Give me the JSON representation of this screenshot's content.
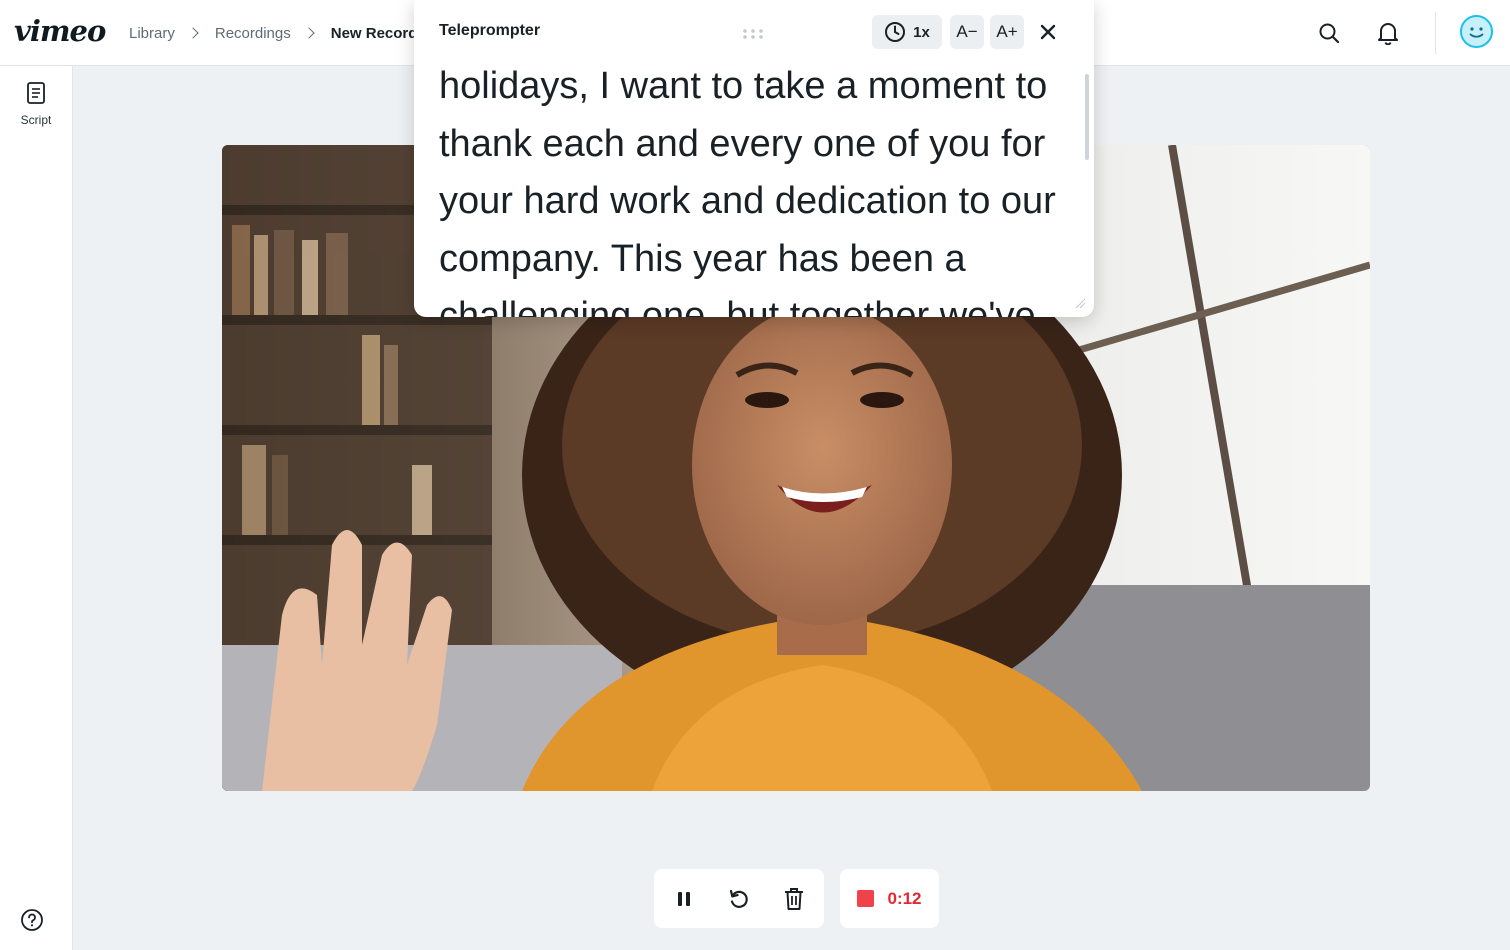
{
  "app": {
    "logo": "vimeo"
  },
  "breadcrumb": [
    {
      "label": "Library"
    },
    {
      "label": "Recordings"
    },
    {
      "label": "New Recordir"
    }
  ],
  "header_icons": [
    "search-icon",
    "bell-icon",
    "avatar"
  ],
  "sidebar": {
    "script_label": "Script",
    "script_icon": "document-icon",
    "help_icon": "help-icon"
  },
  "teleprompter": {
    "title": "Teleprompter",
    "speed": "1x",
    "font_decrease": "A−",
    "font_increase": "A+",
    "text": "holidays, I want to take a moment to thank each and every one of you for your hard work and dedication to our company. This year has been a challenging one, but together we've"
  },
  "recording": {
    "controls": [
      "pause-icon",
      "restart-icon",
      "trash-icon"
    ],
    "elapsed": "0:12",
    "stop_color": "#f0424a"
  },
  "colors": {
    "accent": "#17c0ef",
    "record": "#e5282f"
  }
}
